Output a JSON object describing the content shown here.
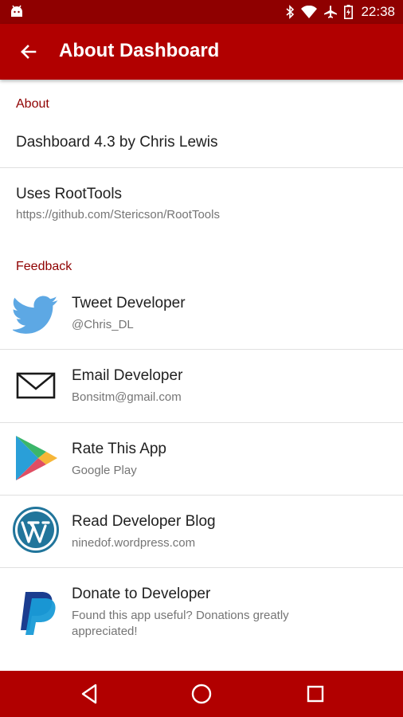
{
  "status_bar": {
    "time": "22:38"
  },
  "app_bar": {
    "title": "About Dashboard"
  },
  "sections": {
    "about_header": "About",
    "feedback_header": "Feedback"
  },
  "about": {
    "version_title": "Dashboard 4.3 by Chris Lewis",
    "roottools_title": "Uses RootTools",
    "roottools_url": "https://github.com/Stericson/RootTools"
  },
  "feedback": [
    {
      "title": "Tweet Developer",
      "subtitle": "@Chris_DL",
      "icon": "twitter-icon"
    },
    {
      "title": "Email Developer",
      "subtitle": "Bonsitm@gmail.com",
      "icon": "envelope-icon"
    },
    {
      "title": "Rate This App",
      "subtitle": "Google Play",
      "icon": "google-play-icon"
    },
    {
      "title": "Read Developer Blog",
      "subtitle": "ninedof.wordpress.com",
      "icon": "wordpress-icon"
    },
    {
      "title": "Donate to Developer",
      "subtitle_line1": "Found this app useful? Donations greatly",
      "subtitle_line2": "appreciated!",
      "icon": "paypal-icon"
    }
  ],
  "colors": {
    "status_bar": "#8f0000",
    "app_bar": "#b10000",
    "section_header": "#8f0000"
  }
}
